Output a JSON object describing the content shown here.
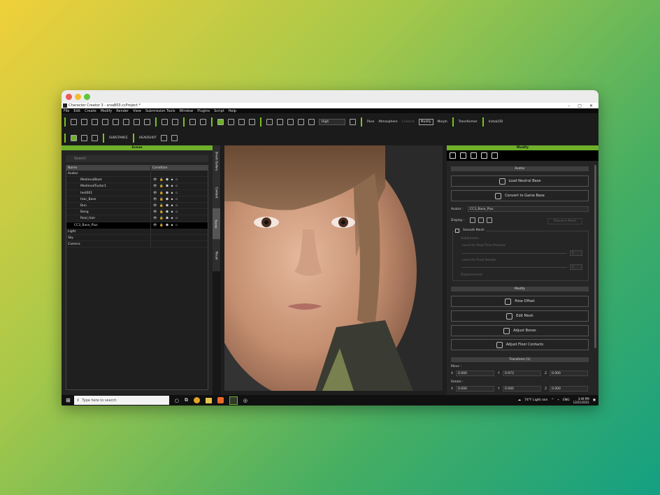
{
  "window": {
    "title": "Character Creator 3 - srsa803.ccProject *",
    "min": "–",
    "max": "▢",
    "close": "✕"
  },
  "menu": [
    "File",
    "Edit",
    "Create",
    "Modify",
    "Render",
    "View",
    "Submission Tools",
    "Window",
    "Plugins",
    "Script",
    "Help"
  ],
  "toolbar": {
    "quality": "High",
    "pose": "Pose",
    "atmosphere": "Atmosphere",
    "content": "Content",
    "modify": "Modify",
    "morph": "Morph",
    "transformer": "Transformer",
    "instalod": "InstaLOD",
    "headshot": "HEADSHOT",
    "substance": "SUBSTANCE"
  },
  "scene": {
    "title": "Scene",
    "search_placeholder": "Search",
    "col_name": "Name",
    "col_condition": "Condition",
    "rows": [
      {
        "name": "Avatar",
        "indent": 0,
        "selected": false,
        "icons": ""
      },
      {
        "name": "MedievalBoot",
        "indent": 2,
        "selected": false,
        "icons": "👁 🔒 ⬢ ▪ ▫"
      },
      {
        "name": "MedievalTuxtor1",
        "indent": 2,
        "selected": false,
        "icons": "👁 🔒 ⬢ ▪ ▫"
      },
      {
        "name": "test001",
        "indent": 2,
        "selected": false,
        "icons": "👁 🔒 ⬢ ▪ ▫"
      },
      {
        "name": "Hair_Base",
        "indent": 2,
        "selected": false,
        "icons": "👁 🔒 ⬢ ▪ ▫"
      },
      {
        "name": "Bun",
        "indent": 2,
        "selected": false,
        "icons": "👁 🔒 ⬢ ▪ ▫"
      },
      {
        "name": "Bang",
        "indent": 2,
        "selected": false,
        "icons": "👁 🔒 ⬢ ▪ ▫"
      },
      {
        "name": "Real_Hair",
        "indent": 2,
        "selected": false,
        "icons": "👁 🔒 ⬢ ▪ ▫"
      },
      {
        "name": "CC3_Base_Plus",
        "indent": 1,
        "selected": true,
        "icons": "👁 🔒 ⬢ ▪ ▫"
      },
      {
        "name": "Light",
        "indent": 0,
        "selected": false,
        "icons": ""
      },
      {
        "name": "Sky",
        "indent": 0,
        "selected": false,
        "icons": ""
      },
      {
        "name": "Camera",
        "indent": 0,
        "selected": false,
        "icons": ""
      }
    ]
  },
  "side_tabs": [
    "Smart Gallery",
    "Content",
    "Scene",
    "Visual"
  ],
  "modify": {
    "title": "Modify",
    "avatar_section": "Avatar",
    "load_neutral": "Load Neutral Base",
    "convert_game": "Convert to Game Base",
    "avatar_label": "Avatar :",
    "avatar_value": "CC3_Base_Plus",
    "display_label": "Display :",
    "dissolve": "Dissolve Mesh",
    "smooth_mesh": "Smooth Mesh",
    "subdivision": "Subdivision",
    "level_max": "Level for Real-Time Preview",
    "level_render": "Level for Final Render",
    "level_val": "1",
    "displacement": "Displacement",
    "modify_section": "Modify",
    "pose_offset": "Pose Offset",
    "edit_mesh": "Edit Mesh",
    "adjust_bones": "Adjust Bones",
    "adjust_floor": "Adjust Floor Contacts",
    "transform_section": "Transform (1)",
    "move": "Move :",
    "rotate": "Rotate :",
    "move_x": "0.000",
    "move_y": "0.973",
    "move_z": "0.000",
    "rot_x": "0.000",
    "rot_y": "0.000",
    "rot_z": "0.000"
  },
  "taskbar": {
    "search": "Type here to search",
    "weather": "74°F  Light rain",
    "lang": "ENG",
    "time": "3:49 PM",
    "date": "12/21/2021"
  }
}
